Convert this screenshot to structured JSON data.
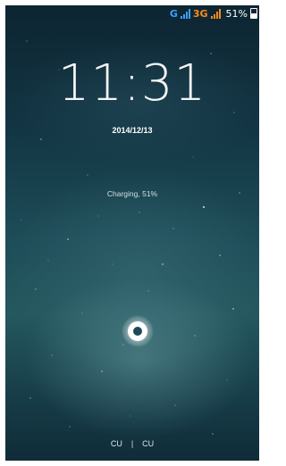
{
  "status_bar": {
    "network1_type": "G",
    "network2_type": "3G",
    "battery_percent": "51%",
    "network1_color": "#3aa0ff",
    "network2_color": "#ff8a1a"
  },
  "lockscreen": {
    "time": "11:31",
    "date": "2014/12/13",
    "charging_status": "Charging, 51%",
    "unlock_icon": "unlock-ring-icon"
  },
  "carriers": {
    "sim1": "CU",
    "separator": "|",
    "sim2": "CU"
  }
}
